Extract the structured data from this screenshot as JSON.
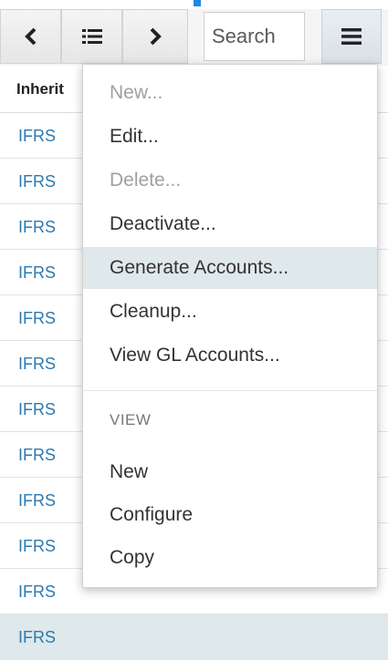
{
  "toolbar": {
    "prev_icon": "chevron-left-icon",
    "list_icon": "list-icon",
    "next_icon": "chevron-right-icon",
    "search_placeholder": "Search",
    "menu_icon": "hamburger-menu-icon"
  },
  "table": {
    "header": "Inherit",
    "rows": [
      "IFRS",
      "IFRS",
      "IFRS",
      "IFRS",
      "IFRS",
      "IFRS",
      "IFRS",
      "IFRS",
      "IFRS",
      "IFRS",
      "IFRS",
      "IFRS"
    ],
    "selected_row_index": 11
  },
  "menu": {
    "items": [
      {
        "label": "New...",
        "enabled": false
      },
      {
        "label": "Edit...",
        "enabled": true
      },
      {
        "label": "Delete...",
        "enabled": false
      },
      {
        "label": "Deactivate...",
        "enabled": true
      },
      {
        "label": "Generate Accounts...",
        "enabled": true,
        "highlighted": true
      },
      {
        "label": "Cleanup...",
        "enabled": true
      },
      {
        "label": "View GL Accounts...",
        "enabled": true
      }
    ],
    "view_section_title": "VIEW",
    "view_items": [
      "New",
      "Configure",
      "Copy"
    ]
  },
  "colors": {
    "accent": "#1e88e5",
    "link": "#2a7ab0",
    "highlight": "#dfe8ea"
  }
}
